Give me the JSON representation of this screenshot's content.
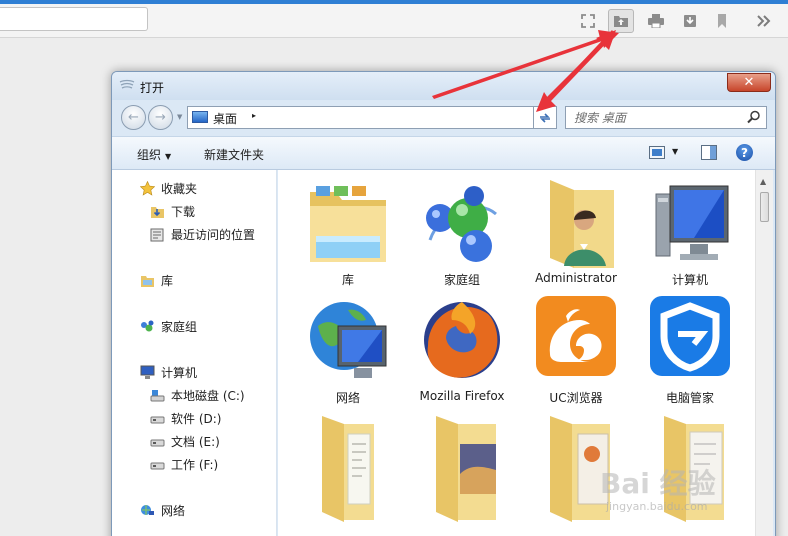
{
  "dialog": {
    "title": "打开",
    "close_label": "✕"
  },
  "navbar": {
    "back_label": "←",
    "forward_label": "→",
    "path_location": "桌面",
    "path_sep": "▸",
    "search_placeholder": "搜索 桌面"
  },
  "commandbar": {
    "organize_label": "组织",
    "new_folder_label": "新建文件夹",
    "help_label": "?"
  },
  "nav_pane": {
    "items": [
      {
        "label": "收藏夹",
        "icon": "star-icon"
      },
      {
        "label": "下载",
        "icon": "download-folder-icon"
      },
      {
        "label": "最近访问的位置",
        "icon": "recent-places-icon"
      },
      {
        "label": "库",
        "icon": "library-icon"
      },
      {
        "label": "家庭组",
        "icon": "homegroup-icon"
      },
      {
        "label": "计算机",
        "icon": "computer-icon"
      },
      {
        "label": "本地磁盘 (C:)",
        "icon": "system-drive-icon"
      },
      {
        "label": "软件 (D:)",
        "icon": "drive-icon"
      },
      {
        "label": "文档 (E:)",
        "icon": "drive-icon"
      },
      {
        "label": "工作 (F:)",
        "icon": "drive-icon"
      },
      {
        "label": "网络",
        "icon": "network-icon"
      }
    ]
  },
  "files": [
    {
      "label": "库",
      "icon": "library-folder-icon"
    },
    {
      "label": "家庭组",
      "icon": "homegroup-spheres-icon"
    },
    {
      "label": "Administrator",
      "icon": "user-folder-icon"
    },
    {
      "label": "计算机",
      "icon": "computer-monitor-icon"
    },
    {
      "label": "网络",
      "icon": "network-globe-icon"
    },
    {
      "label": "Mozilla Firefox",
      "icon": "firefox-icon"
    },
    {
      "label": "UC浏览器",
      "icon": "uc-browser-icon"
    },
    {
      "label": "电脑管家",
      "icon": "pc-manager-shield-icon"
    },
    {
      "label": "",
      "icon": "folder-icon"
    },
    {
      "label": "",
      "icon": "folder-icon"
    },
    {
      "label": "",
      "icon": "folder-icon"
    },
    {
      "label": "",
      "icon": "folder-icon"
    }
  ],
  "watermark": {
    "brand": "Bai 经验",
    "url": "jingyan.baidu.com"
  },
  "colors": {
    "accent": "#2f7fd4",
    "annotation_red": "#e8333a",
    "uc_orange": "#f28b1f",
    "pc_manager_blue": "#1a7be6"
  }
}
